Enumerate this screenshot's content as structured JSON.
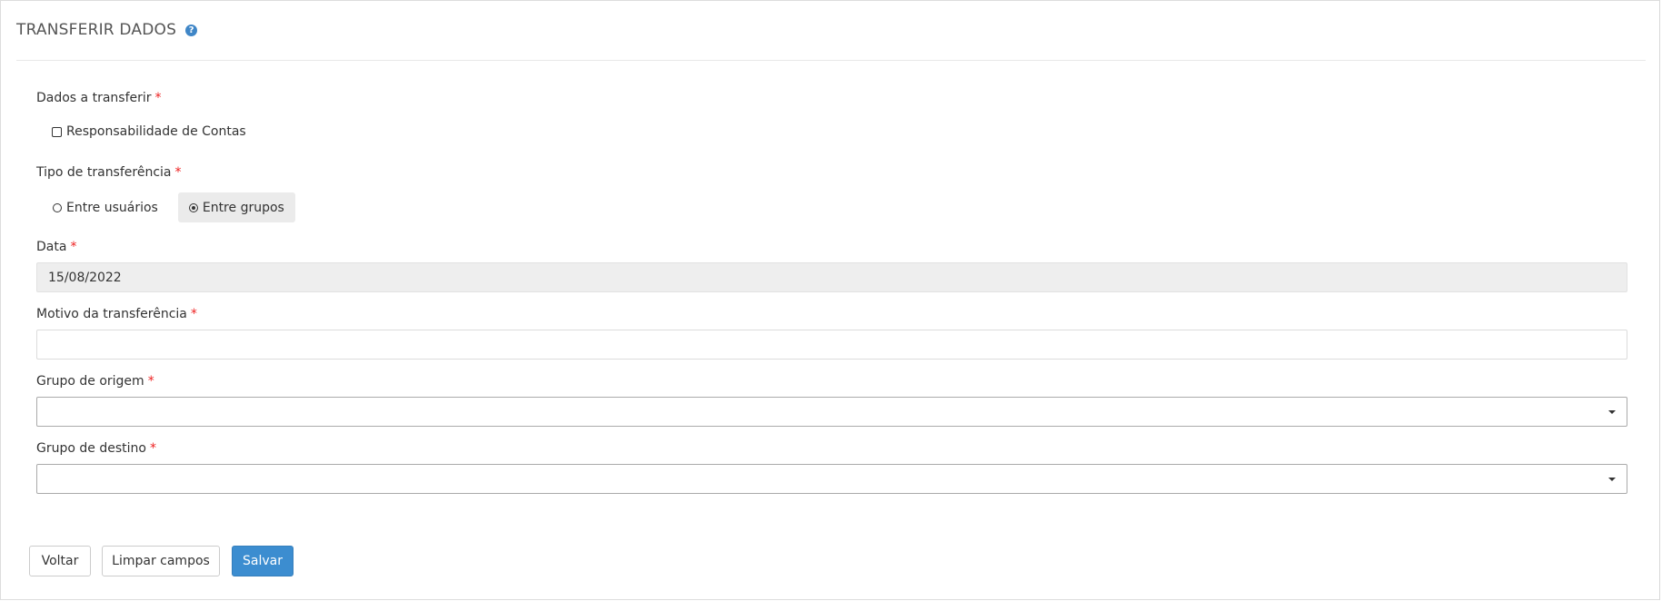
{
  "header": {
    "title": "TRANSFERIR DADOS",
    "help_icon": "?"
  },
  "fields": {
    "dados_label": "Dados a transferir",
    "required_mark": "*",
    "checkbox_label": "Responsabilidade de Contas",
    "checkbox_checked": false,
    "tipo_label": "Tipo de transferência",
    "radio_options": [
      {
        "label": "Entre usuários",
        "selected": false
      },
      {
        "label": "Entre grupos",
        "selected": true
      }
    ],
    "data_label": "Data",
    "data_value": "15/08/2022",
    "motivo_label": "Motivo da transferência",
    "motivo_value": "",
    "origem_label": "Grupo de origem",
    "origem_value": "",
    "destino_label": "Grupo de destino",
    "destino_value": ""
  },
  "buttons": {
    "back": "Voltar",
    "clear": "Limpar campos",
    "save": "Salvar"
  }
}
